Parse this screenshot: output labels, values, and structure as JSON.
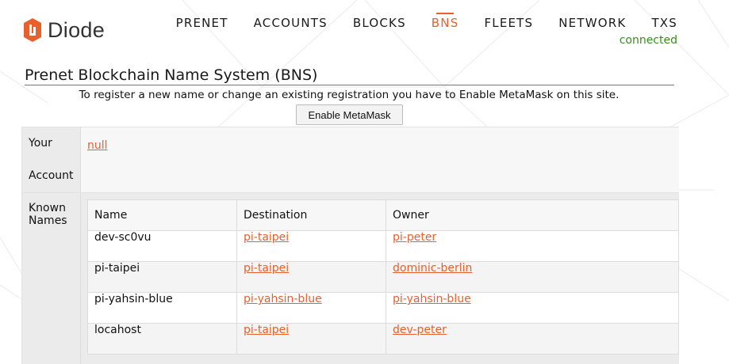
{
  "brand": {
    "name": "Diode",
    "accent": "#e8602c"
  },
  "nav": {
    "items": [
      {
        "label": "PRENET",
        "active": false
      },
      {
        "label": "ACCOUNTS",
        "active": false
      },
      {
        "label": "BLOCKS",
        "active": false
      },
      {
        "label": "BNS",
        "active": true
      },
      {
        "label": "FLEETS",
        "active": false
      },
      {
        "label": "NETWORK",
        "active": false
      },
      {
        "label": "TXS",
        "active": false
      }
    ],
    "status": "connected",
    "status_color": "#3c8a1f"
  },
  "page": {
    "title": "Prenet Blockchain Name System (BNS)",
    "notice": "To register a new name or change an existing registration you have to Enable MetaMask on this site.",
    "metamask_button": "Enable MetaMask"
  },
  "account": {
    "label": "Your Account",
    "value": "null"
  },
  "names": {
    "label": "Known Names",
    "columns": [
      "Name",
      "Destination",
      "Owner"
    ],
    "rows": [
      {
        "name": "dev-sc0vu",
        "destination": "pi-taipei",
        "owner": "pi-peter"
      },
      {
        "name": "pi-taipei",
        "destination": "pi-taipei",
        "owner": "dominic-berlin"
      },
      {
        "name": "pi-yahsin-blue",
        "destination": "pi-yahsin-blue",
        "owner": "pi-yahsin-blue"
      },
      {
        "name": "locahost",
        "destination": "pi-taipei",
        "owner": "dev-peter"
      }
    ]
  }
}
